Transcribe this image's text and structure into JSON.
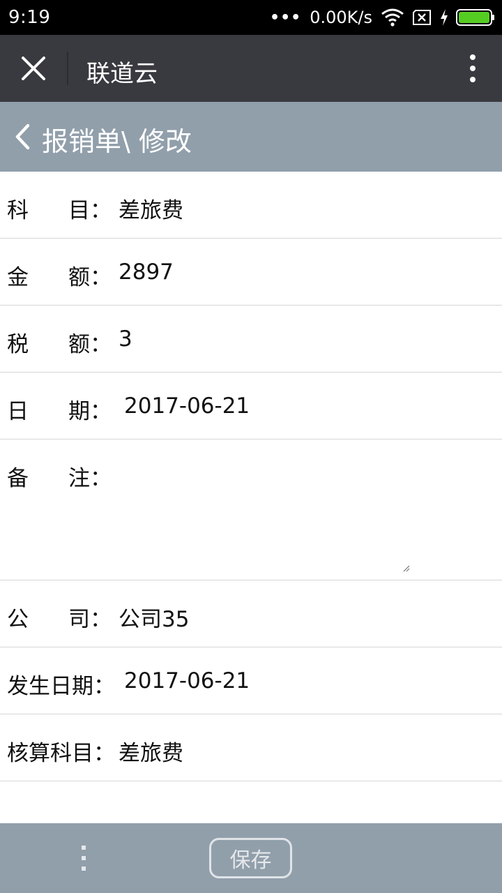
{
  "status_bar": {
    "time": "9:19",
    "dots": "•••",
    "speed": "0.00K/s"
  },
  "title_bar": {
    "title": "联道云"
  },
  "page_header": {
    "title": "报销单\\ 修改"
  },
  "form": {
    "subject": {
      "label_a": "科",
      "label_b": "目：",
      "value": "差旅费"
    },
    "amount": {
      "label_a": "金",
      "label_b": "额：",
      "value": "2897"
    },
    "tax": {
      "label_a": "税",
      "label_b": "额：",
      "value": "3"
    },
    "date": {
      "label_a": "日",
      "label_b": "期：",
      "value": "2017-06-21"
    },
    "remark": {
      "label_a": "备",
      "label_b": "注：",
      "value": ""
    },
    "company": {
      "label_a": "公",
      "label_b": "司：",
      "value": "公司35"
    },
    "occur_date": {
      "label": "发生日期：",
      "value": "2017-06-21"
    },
    "account_subject": {
      "label": "核算科目：",
      "value": "差旅费"
    }
  },
  "bottom_bar": {
    "save_label": "保存"
  },
  "colors": {
    "status_bg": "#000000",
    "titlebar_bg": "#393a3f",
    "header_bg": "#919fab",
    "battery": "#55cc22",
    "divider": "#d6d6d6"
  },
  "icons": {
    "close": "close-icon",
    "more": "more-vertical-icon",
    "back": "chevron-left-icon",
    "wifi": "wifi-icon",
    "sim": "sim-x-icon",
    "charging": "charging-icon",
    "battery": "battery-icon"
  }
}
